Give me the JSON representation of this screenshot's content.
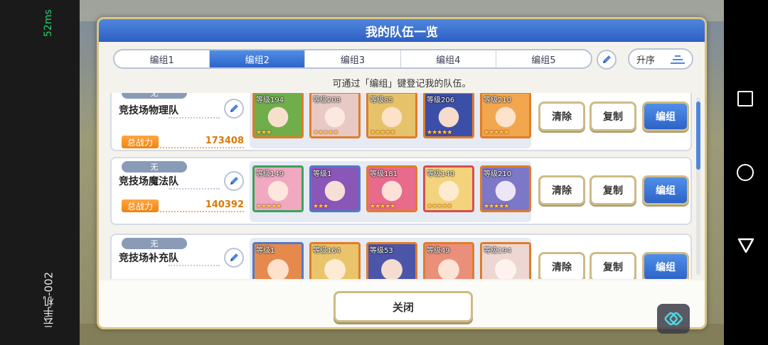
{
  "emulator": {
    "latency": "52ms",
    "device_label": "云手机-002"
  },
  "modal": {
    "title": "我的队伍一览",
    "tabs": [
      {
        "label": "编组1",
        "active": false
      },
      {
        "label": "编组2",
        "active": true
      },
      {
        "label": "编组3",
        "active": false
      },
      {
        "label": "编组4",
        "active": false
      },
      {
        "label": "编组5",
        "active": false
      }
    ],
    "sort_label": "升序",
    "hint": "可通过「编组」键登记我的队伍。",
    "close_label": "关闭"
  },
  "teams": [
    {
      "tag": "无",
      "name": "竞技场物理队",
      "power_label": "总战力",
      "power": "173408",
      "chars": [
        {
          "level": "等级194",
          "frame": "orange",
          "color": "#6fae4a",
          "stars": "★★★"
        },
        {
          "level": "等级208",
          "frame": "orange",
          "color": "#e9c9c4",
          "stars": "★★★★★"
        },
        {
          "level": "等级85",
          "frame": "orange",
          "color": "#e6c36a",
          "stars": "★★★★★"
        },
        {
          "level": "等级206",
          "frame": "orange",
          "color": "#3c4fa8",
          "stars": "★★★★★"
        },
        {
          "level": "等级210",
          "frame": "orange",
          "color": "#f2a64e",
          "stars": "★★★★★"
        }
      ],
      "buttons": {
        "clear": "清除",
        "copy": "复制",
        "edit": "编组"
      }
    },
    {
      "tag": "无",
      "name": "竞技场魔法队",
      "power_label": "总战力",
      "power": "140392",
      "chars": [
        {
          "level": "等级149",
          "frame": "green",
          "color": "#f0a9c0",
          "stars": "★★★★★"
        },
        {
          "level": "等级1",
          "frame": "blue",
          "color": "#8a56b8",
          "stars": "★★★"
        },
        {
          "level": "等级181",
          "frame": "orange",
          "color": "#e86b8c",
          "stars": "★★★★★"
        },
        {
          "level": "等级140",
          "frame": "red",
          "color": "#f3d37c",
          "stars": "★★★★★"
        },
        {
          "level": "等级210",
          "frame": "orange",
          "color": "#7d77c8",
          "stars": "★★★★★"
        }
      ],
      "buttons": {
        "clear": "清除",
        "copy": "复制",
        "edit": "编组"
      }
    },
    {
      "tag": "无",
      "name": "竞技场补充队",
      "chars": [
        {
          "level": "等级1",
          "frame": "blue",
          "color": "#e58a4c",
          "stars": ""
        },
        {
          "level": "等级164",
          "frame": "orange",
          "color": "#e9c46a",
          "stars": ""
        },
        {
          "level": "等级53",
          "frame": "orange",
          "color": "#4c55a8",
          "stars": ""
        },
        {
          "level": "等级49",
          "frame": "orange",
          "color": "#e98f7a",
          "stars": ""
        },
        {
          "level": "等级194",
          "frame": "orange",
          "color": "#eed7d2",
          "stars": ""
        }
      ],
      "buttons": {
        "clear": "清除",
        "copy": "复制",
        "edit": "编组"
      }
    }
  ],
  "colors": {
    "header_blue": "#2e5fc4",
    "accent_orange": "#f08312",
    "frame_gold": "#cdbb86"
  }
}
